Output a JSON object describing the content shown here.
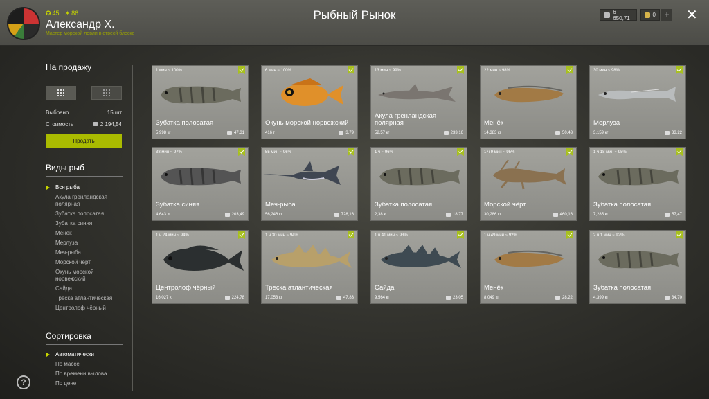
{
  "header": {
    "level": "45",
    "rank": "86",
    "username": "Александр Х.",
    "user_title": "Мастер морской ловли в отвесй блеске",
    "title": "Рыбный Рынок",
    "silver": "6 650,71",
    "gold": "0",
    "plus": "+",
    "close": "✕"
  },
  "sidebar": {
    "for_sale_title": "На продажу",
    "selected_label": "Выбрано",
    "selected_value": "15 шт",
    "cost_label": "Стоимость",
    "cost_value": "2 194,54",
    "sell_button": "Продать",
    "fish_types_title": "Виды рыб",
    "fish_types": [
      "Вся рыба",
      "Акула гренландская полярная",
      "Зубатка полосатая",
      "Зубатка синяя",
      "Менёк",
      "Мерлуза",
      "Меч-рыба",
      "Морской чёрт",
      "Окунь морской норвежский",
      "Сайда",
      "Треска атлантическая",
      "Центролоф чёрный"
    ],
    "sort_title": "Сортировка",
    "sort_options": [
      "Автоматически",
      "По массе",
      "По времени вылова",
      "По цене"
    ]
  },
  "help": "?",
  "fish": [
    {
      "time": "1 мин ~ 100%",
      "name": "Зубатка полосатая",
      "weight": "5,998 кг",
      "price": "47,31",
      "color": "#6b6b5e",
      "shape": "wolf"
    },
    {
      "time": "6 мин ~ 100%",
      "name": "Окунь морской норвежский",
      "weight": "416 г",
      "price": "3,79",
      "color": "#e0902a",
      "shape": "perch"
    },
    {
      "time": "13 мин ~ 99%",
      "name": "Акула гренландская полярная",
      "weight": "52,57 кг",
      "price": "233,16",
      "color": "#7a7570",
      "shape": "shark"
    },
    {
      "time": "22 мин ~ 98%",
      "name": "Менёк",
      "weight": "14,383 кг",
      "price": "50,43",
      "color": "#a27a45",
      "shape": "eel"
    },
    {
      "time": "30 мин ~ 98%",
      "name": "Мерлуза",
      "weight": "3,159 кг",
      "price": "33,22",
      "color": "#b9bcbd",
      "shape": "hake"
    },
    {
      "time": "38 мин ~ 97%",
      "name": "Зубатка синяя",
      "weight": "4,643 кг",
      "price": "203,49",
      "color": "#545454",
      "shape": "wolf"
    },
    {
      "time": "55 мин ~ 96%",
      "name": "Меч-рыба",
      "weight": "56,246 кг",
      "price": "728,16",
      "color": "#3f4652",
      "shape": "sword"
    },
    {
      "time": "1 ч ~ 96%",
      "name": "Зубатка полосатая",
      "weight": "2,38 кг",
      "price": "18,77",
      "color": "#6b6b5e",
      "shape": "wolf"
    },
    {
      "time": "1 ч 9 мин ~ 95%",
      "name": "Морской чёрт",
      "weight": "30,286 кг",
      "price": "460,16",
      "color": "#8a7150",
      "shape": "monk"
    },
    {
      "time": "1 ч 18 мин ~ 95%",
      "name": "Зубатка полосатая",
      "weight": "7,285 кг",
      "price": "57,47",
      "color": "#6b6b5e",
      "shape": "wolf"
    },
    {
      "time": "1 ч 24 мин ~ 94%",
      "name": "Центролоф чёрный",
      "weight": "16,027 кг",
      "price": "224,78",
      "color": "#2b2f30",
      "shape": "deep"
    },
    {
      "time": "1 ч 30 мин ~ 94%",
      "name": "Треска атлантическая",
      "weight": "17,053 кг",
      "price": "47,83",
      "color": "#b8a06a",
      "shape": "cod"
    },
    {
      "time": "1 ч 41 мин ~ 93%",
      "name": "Сайда",
      "weight": "9,564 кг",
      "price": "23,05",
      "color": "#3e4a52",
      "shape": "cod"
    },
    {
      "time": "1 ч 49 мин ~ 92%",
      "name": "Менёк",
      "weight": "8,049 кг",
      "price": "28,22",
      "color": "#a27a45",
      "shape": "eel"
    },
    {
      "time": "2 ч 1 мин ~ 92%",
      "name": "Зубатка полосатая",
      "weight": "4,399 кг",
      "price": "34,70",
      "color": "#6b6b5e",
      "shape": "wolf"
    }
  ]
}
